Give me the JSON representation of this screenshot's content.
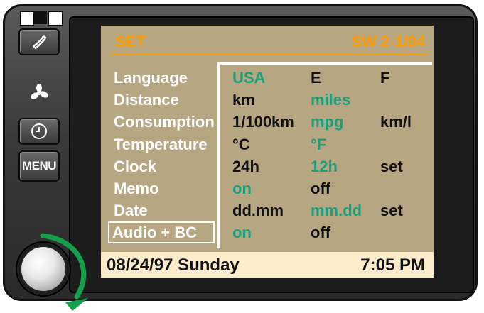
{
  "header": {
    "title": "SET",
    "version": "SW 2-1/04"
  },
  "side_controls": {
    "menu_label": "MENU"
  },
  "settings": [
    {
      "label": "Language",
      "options": [
        "USA",
        "E",
        "F"
      ],
      "active": [
        0
      ]
    },
    {
      "label": "Distance",
      "options": [
        "km",
        "miles"
      ],
      "active": [
        1
      ]
    },
    {
      "label": "Consumption",
      "options": [
        "1/100km",
        "mpg",
        "km/l"
      ],
      "active": [
        1
      ]
    },
    {
      "label": "Temperature",
      "options": [
        "°C",
        "°F"
      ],
      "active": [
        1
      ]
    },
    {
      "label": "Clock",
      "options": [
        "24h",
        "12h",
        "set"
      ],
      "active": [
        1
      ]
    },
    {
      "label": "Memo",
      "options": [
        "on",
        "off"
      ],
      "active": [
        0
      ]
    },
    {
      "label": "Date",
      "options": [
        "dd.mm",
        "mm.dd",
        "set"
      ],
      "active": [
        1
      ]
    },
    {
      "label": "Audio + BC",
      "options": [
        "on",
        "off"
      ],
      "active": [
        0
      ],
      "selected": true
    }
  ],
  "status_bar": {
    "date": "08/24/97  Sunday",
    "time": "7:05 PM"
  },
  "colors": {
    "screen_bg": "#b7a682",
    "title": "#ff9c00",
    "active_option": "#1aa07d",
    "status_bg": "#fdeccb",
    "arrow": "#12a04a"
  }
}
